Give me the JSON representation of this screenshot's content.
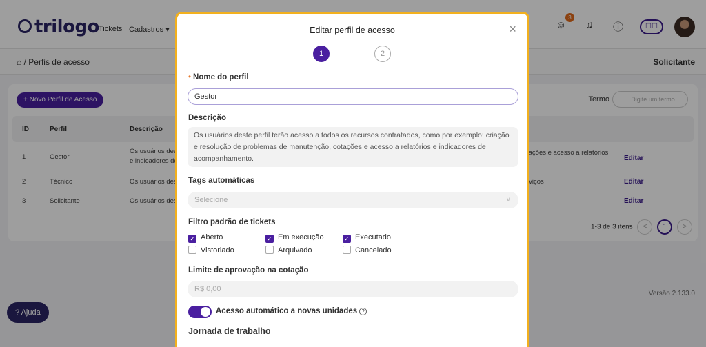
{
  "app": {
    "logo": "trilogo",
    "nav": [
      "Tickets",
      "Cadastros ▾"
    ],
    "notifications_badge": "3",
    "book_label": "☐☐",
    "breadcrumb": "Perfis de acesso",
    "role": "Solicitante",
    "new_button": "+ Novo Perfil de Acesso",
    "term_label": "Termo",
    "term_placeholder": "Digite um termo",
    "columns": [
      "ID",
      "Perfil",
      "Descrição"
    ],
    "rows": [
      {
        "id": "1",
        "perfil": "Gestor",
        "desc": "Os usuários des",
        "desc2": "e indicadores de",
        "tail": "tações e acesso a relatórios",
        "edit": "Editar"
      },
      {
        "id": "2",
        "perfil": "Técnico",
        "desc": "Os usuários des",
        "desc2": "",
        "tail": "rviços",
        "edit": "Editar"
      },
      {
        "id": "3",
        "perfil": "Solicitante",
        "desc": "Os usuários des",
        "desc2": "",
        "tail": "",
        "edit": "Editar"
      }
    ],
    "pager_text": "1-3 de 3 itens",
    "pager_prev": "<",
    "pager_page": "1",
    "pager_next": ">",
    "version": "Versão 2.133.0",
    "help_label": "? Ajuda"
  },
  "modal": {
    "title": "Editar perfil de acesso",
    "close": "×",
    "steps": [
      "1",
      "2"
    ],
    "name_label": "Nome do perfil",
    "name_value": "Gestor",
    "desc_label": "Descrição",
    "desc_value": "Os usuários deste perfil terão acesso a todos os recursos contratados, como por exemplo: criação e resolução de problemas de manutenção, cotações e acesso a relatórios e indicadores de acompanhamento.",
    "tags_label": "Tags automáticas",
    "tags_placeholder": "Selecione",
    "filter_label": "Filtro padrão de tickets",
    "filters": [
      {
        "label": "Aberto",
        "checked": true
      },
      {
        "label": "Em execução",
        "checked": true
      },
      {
        "label": "Executado",
        "checked": true
      },
      {
        "label": "Vistoriado",
        "checked": false
      },
      {
        "label": "Arquivado",
        "checked": false
      },
      {
        "label": "Cancelado",
        "checked": false
      }
    ],
    "limit_label": "Limite de aprovação na cotação",
    "limit_placeholder": "R$ 0,00",
    "auto_access_label": "Acesso automático a novas unidades",
    "auto_access_on": true,
    "jornada_label": "Jornada de trabalho"
  }
}
